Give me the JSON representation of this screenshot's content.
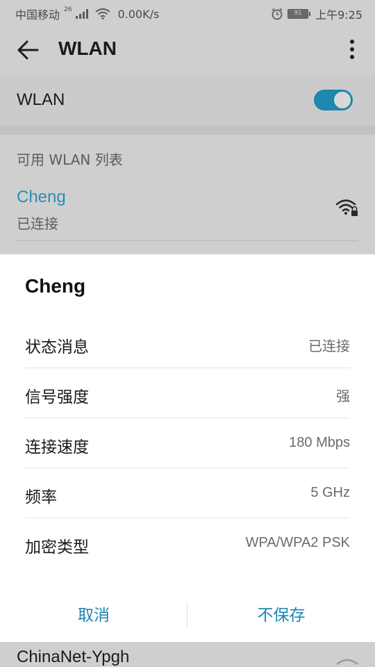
{
  "status_bar": {
    "carrier": "中国移动",
    "network_type": "26",
    "speed": "0.00K/s",
    "battery": "91",
    "time": "上午9:25"
  },
  "header": {
    "title": "WLAN"
  },
  "wlan_switch": {
    "label": "WLAN",
    "enabled": true
  },
  "list": {
    "section_title": "可用 WLAN 列表",
    "connected": {
      "name": "Cheng",
      "status": "已连接"
    },
    "next_network": {
      "name": "ChinaNet-Ypgh"
    }
  },
  "dialog": {
    "title": "Cheng",
    "rows": [
      {
        "key": "状态消息",
        "value": "已连接"
      },
      {
        "key": "信号强度",
        "value": "强"
      },
      {
        "key": "连接速度",
        "value": "180 Mbps"
      },
      {
        "key": "频率",
        "value": "5 GHz"
      },
      {
        "key": "加密类型",
        "value": "WPA/WPA2 PSK"
      }
    ],
    "cancel_label": "取消",
    "forget_label": "不保存"
  },
  "colors": {
    "accent": "#1f86ad",
    "dim_background": "#cfcfcf",
    "dialog_background": "#ffffff"
  }
}
